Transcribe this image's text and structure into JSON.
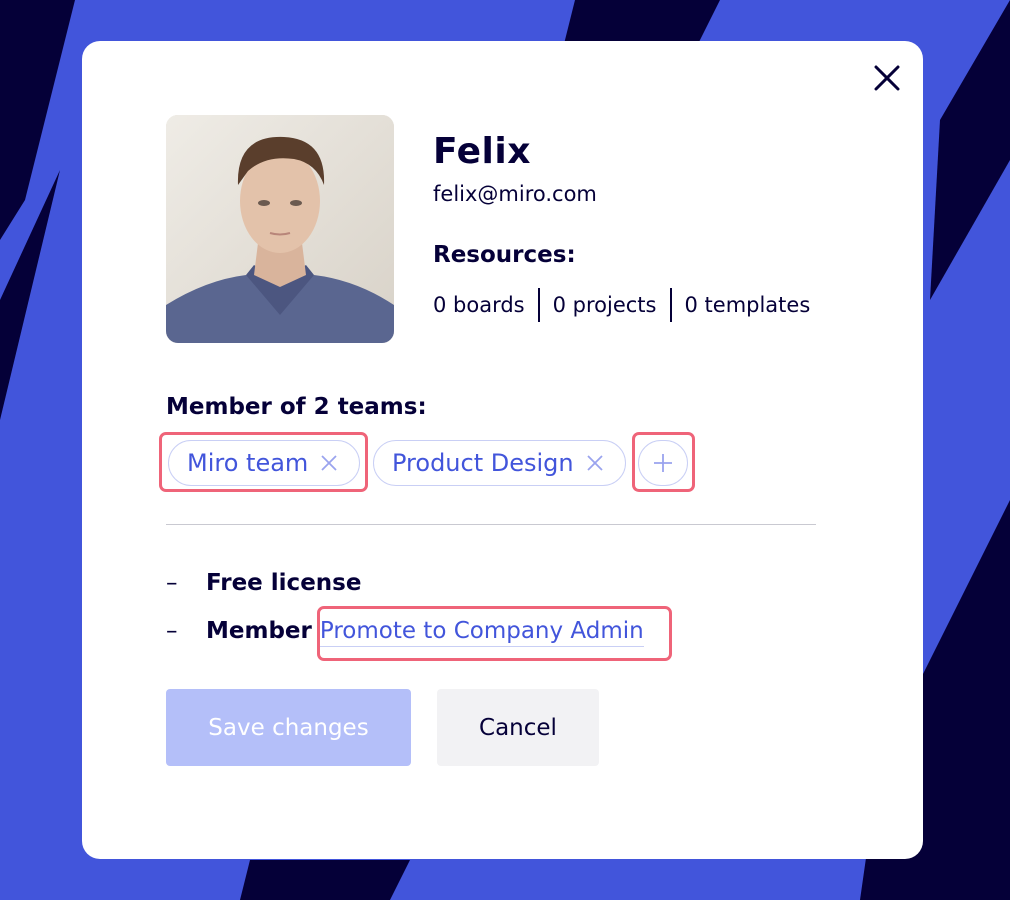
{
  "colors": {
    "background": "#4255db",
    "stripe": "#050038",
    "accent": "#4255db",
    "text": "#050038",
    "highlight": "#ef6479",
    "save_disabled": "#b4bff9"
  },
  "user": {
    "name": "Felix",
    "email": "felix@miro.com"
  },
  "resources": {
    "heading": "Resources:",
    "items": [
      "0 boards",
      "0 projects",
      "0 templates"
    ]
  },
  "teams": {
    "heading": "Member of 2 teams:",
    "items": [
      {
        "label": "Miro team"
      },
      {
        "label": "Product Design"
      }
    ],
    "add_icon": "plus-icon",
    "remove_icon": "close-icon"
  },
  "license": {
    "bullet": "–",
    "text": "Free license"
  },
  "role": {
    "bullet": "–",
    "text": "Member",
    "promote_link": "Promote to Company Admin"
  },
  "buttons": {
    "save": "Save changes",
    "cancel": "Cancel"
  },
  "icons": {
    "close": "close-icon"
  }
}
